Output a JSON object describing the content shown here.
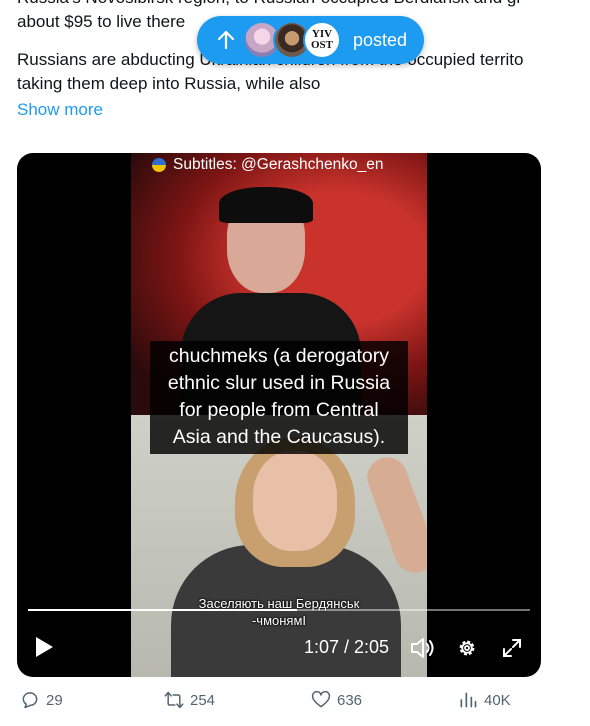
{
  "tweet": {
    "lines": [
      "Russia's Novosibirsk region, to Russian-occupied Berdiansk and gi",
      "about $95 to live there",
      "Russians are abducting Ukrainian children from the occupied territo",
      "taking them deep into Russia, while also"
    ],
    "show_more": "Show more"
  },
  "posted_pill": {
    "label": "posted",
    "arrow_icon": "arrow-up-icon",
    "avatar3_text": [
      "YIV",
      "OST"
    ]
  },
  "video": {
    "subtitle_credit": "Subtitles: @Gerashchenko_en",
    "subtitle_lines": [
      "chuchmeks (a derogatory",
      "ethnic slur used in Russia",
      "for people from Central",
      "Asia and the Caucasus)."
    ],
    "ukrainian_sub": [
      "Заселяють наш Бердянськ",
      "-чмонямI"
    ],
    "time": "1:07 / 2:05",
    "progress_fraction": 0.535
  },
  "actions": {
    "reply_count": "29",
    "retweet_count": "254",
    "like_count": "636",
    "views_count": "40K"
  },
  "colors": {
    "accent": "#1d9bf0",
    "muted": "#536471",
    "text": "#0f1419"
  }
}
